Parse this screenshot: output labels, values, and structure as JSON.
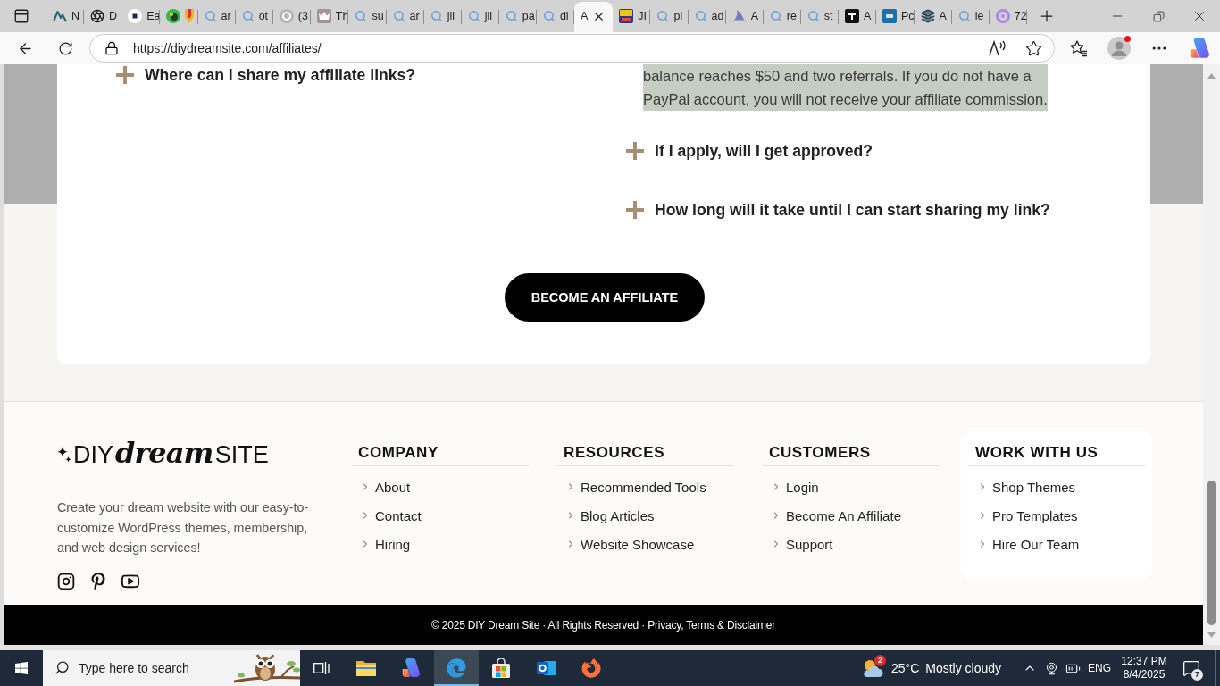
{
  "browser": {
    "tabs": [
      {
        "kind": "site",
        "label": "N",
        "selected": false
      },
      {
        "kind": "site",
        "label": "D",
        "selected": false
      },
      {
        "kind": "site",
        "label": "Ea",
        "selected": false
      },
      {
        "kind": "site",
        "selected": false
      },
      {
        "kind": "search",
        "label": "ar",
        "selected": false
      },
      {
        "kind": "search",
        "label": "ot",
        "selected": false
      },
      {
        "kind": "site",
        "label": "(3",
        "selected": false
      },
      {
        "kind": "site",
        "label": "Th",
        "selected": false
      },
      {
        "kind": "search",
        "label": "su",
        "selected": false
      },
      {
        "kind": "search",
        "label": "ar",
        "selected": false
      },
      {
        "kind": "search",
        "label": "jil",
        "selected": false
      },
      {
        "kind": "search",
        "label": "jil",
        "selected": false
      },
      {
        "kind": "search",
        "label": "pa",
        "selected": false
      },
      {
        "kind": "search",
        "label": "di",
        "selected": false
      },
      {
        "kind": "plain",
        "label": "A",
        "selected": true
      },
      {
        "kind": "site",
        "label": "JI",
        "selected": false
      },
      {
        "kind": "search",
        "label": "pl",
        "selected": false
      },
      {
        "kind": "search",
        "label": "ad",
        "selected": false
      },
      {
        "kind": "site",
        "label": "A",
        "selected": false
      },
      {
        "kind": "search",
        "label": "re",
        "selected": false
      },
      {
        "kind": "search",
        "label": "st",
        "selected": false
      },
      {
        "kind": "site",
        "label": "A",
        "selected": false
      },
      {
        "kind": "site",
        "label": "Pc",
        "selected": false
      },
      {
        "kind": "site",
        "label": "A",
        "selected": false
      },
      {
        "kind": "search",
        "label": "le",
        "selected": false
      },
      {
        "kind": "site",
        "label": "72",
        "selected": false
      }
    ],
    "url": "https://diydreamsite.com/affiliates/"
  },
  "page": {
    "faq_left": [
      {
        "question": "Where can I share my affiliate links?",
        "expanded": false
      }
    ],
    "faq_right": {
      "answer": {
        "lines": [
          "balance reaches $50 and two referrals. If you do not have a",
          "PayPal account, you will not receive your affiliate commission."
        ],
        "highlighted": true
      },
      "items": [
        {
          "question": "If I apply, will I get approved?",
          "expanded": false
        },
        {
          "question": "How long will it take until I can start sharing my link?",
          "expanded": false
        }
      ]
    },
    "cta_button": "BECOME AN AFFILIATE"
  },
  "footer": {
    "logo": {
      "prefix": "DIY",
      "script": "dream",
      "suffix": "SITE"
    },
    "description_lines": [
      "Create your dream website with our easy-to-",
      "customize WordPress themes, membership,",
      "and web design services!"
    ],
    "columns": [
      {
        "heading": "COMPANY",
        "links": [
          "About",
          "Contact",
          "Hiring"
        ],
        "highlighted": false
      },
      {
        "heading": "RESOURCES",
        "links": [
          "Recommended Tools",
          "Blog Articles",
          "Website Showcase"
        ],
        "highlighted": false
      },
      {
        "heading": "CUSTOMERS",
        "links": [
          "Login",
          "Become An Affiliate",
          "Support"
        ],
        "highlighted": false
      },
      {
        "heading": "WORK WITH US",
        "links": [
          "Shop Themes",
          "Pro Templates",
          "Hire Our Team"
        ],
        "highlighted": true
      }
    ],
    "copyright": {
      "text": "© 2025 DIY Dream Site · All Rights Reserved ·",
      "link": "Privacy, Terms & Disclaimer"
    }
  },
  "taskbar": {
    "search": {
      "placeholder": "Type here to search"
    },
    "apps": [
      {
        "active": false
      },
      {
        "active": false
      },
      {
        "active": true
      },
      {
        "active": false
      },
      {
        "active": false
      },
      {
        "active": false
      }
    ],
    "weather": {
      "badge": "2",
      "temperature": "25°C",
      "condition": "Mostly cloudy"
    },
    "language": "ENG",
    "clock": {
      "time": "12:37 PM",
      "date": "8/4/2025"
    },
    "notifications": {
      "badge": "7"
    }
  }
}
